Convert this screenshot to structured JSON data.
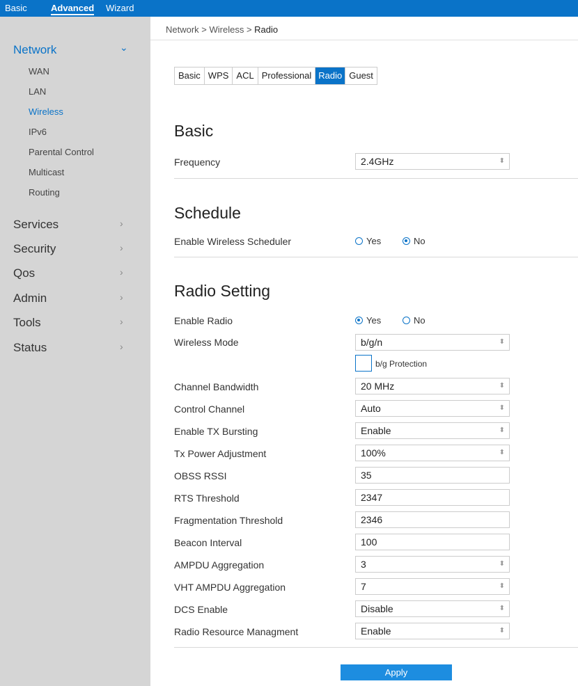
{
  "topbar": {
    "basic": "Basic",
    "advanced": "Advanced",
    "wizard": "Wizard"
  },
  "sidebar": {
    "network": "Network",
    "network_arrow": "⌄",
    "sub": [
      "WAN",
      "LAN",
      "Wireless",
      "IPv6",
      "Parental Control",
      "Multicast",
      "Routing"
    ],
    "items": [
      "Services",
      "Security",
      "Qos",
      "Admin",
      "Tools",
      "Status"
    ],
    "arrow": "›"
  },
  "breadcrumb": {
    "path": "Network > Wireless > ",
    "current": "Radio"
  },
  "tabs": [
    "Basic",
    "WPS",
    "ACL",
    "Professional",
    "Radio",
    "Guest"
  ],
  "basic": {
    "title": "Basic",
    "frequency_label": "Frequency",
    "frequency_value": "2.4GHz"
  },
  "schedule": {
    "title": "Schedule",
    "label": "Enable Wireless Scheduler",
    "yes": "Yes",
    "no": "No",
    "selected": "No"
  },
  "radio": {
    "title": "Radio Setting",
    "enable_label": "Enable Radio",
    "yes": "Yes",
    "no": "No",
    "enable_selected": "Yes",
    "mode_label": "Wireless Mode",
    "mode_value": "b/g/n",
    "bg_protection": "b/g Protection",
    "bandwidth_label": "Channel Bandwidth",
    "bandwidth_value": "20 MHz",
    "channel_label": "Control Channel",
    "channel_value": "Auto",
    "txburst_label": "Enable TX Bursting",
    "txburst_value": "Enable",
    "txpower_label": "Tx Power Adjustment",
    "txpower_value": "100%",
    "obss_label": "OBSS RSSI",
    "obss_value": "35",
    "rts_label": "RTS Threshold",
    "rts_value": "2347",
    "frag_label": "Fragmentation Threshold",
    "frag_value": "2346",
    "beacon_label": "Beacon Interval",
    "beacon_value": "100",
    "ampdu_label": "AMPDU Aggregation",
    "ampdu_value": "3",
    "vht_label": "VHT AMPDU Aggregation",
    "vht_value": "7",
    "dcs_label": "DCS Enable",
    "dcs_value": "Disable",
    "rrm_label": "Radio Resource Managment",
    "rrm_value": "Enable"
  },
  "apply": "Apply",
  "caret": "⬍",
  "colors": {
    "accent": "#0a73c8",
    "sidebar_bg": "#d5d5d5",
    "apply_bg": "#1d8de0"
  }
}
